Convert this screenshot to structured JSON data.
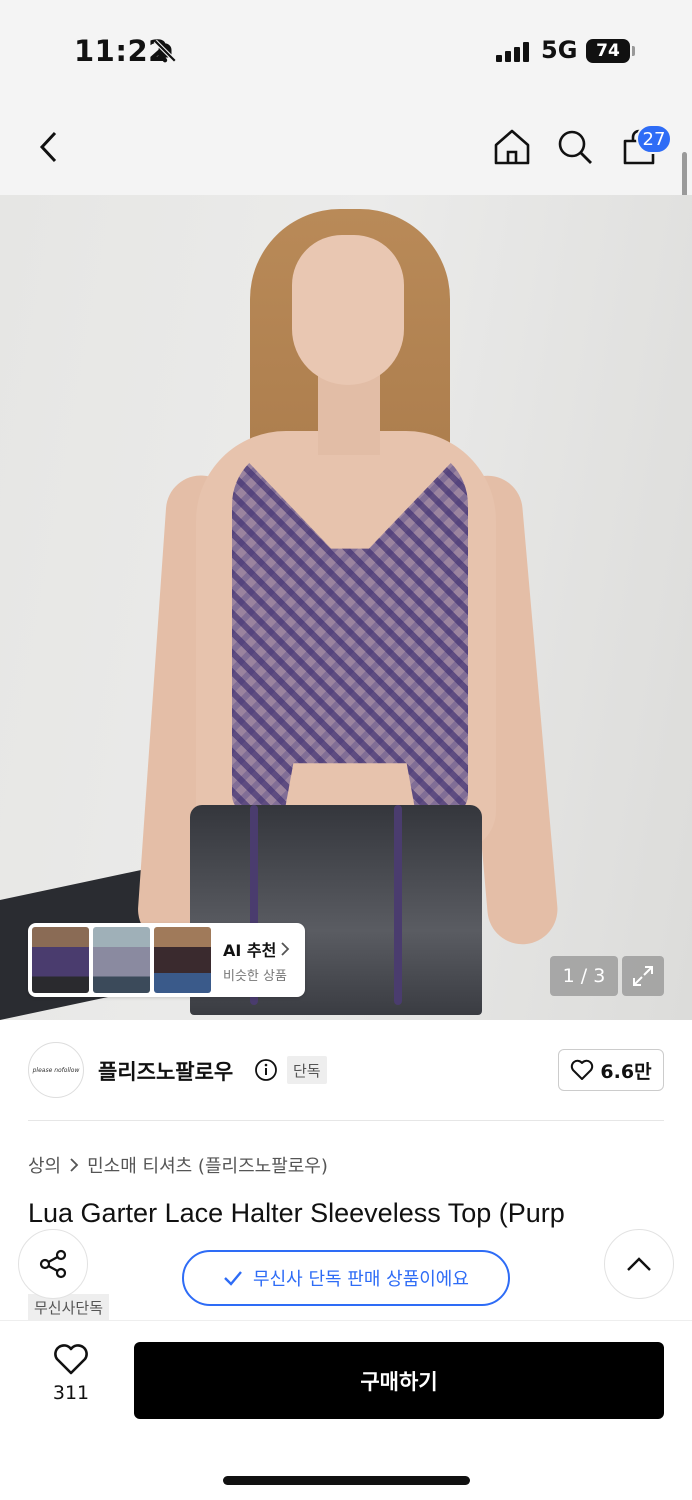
{
  "status_bar": {
    "time": "11:22",
    "network": "5G",
    "battery": "74"
  },
  "header": {
    "cart_count": "27"
  },
  "gallery": {
    "pager": "1 / 3",
    "ai_recommend": {
      "title": "AI 추천",
      "subtitle": "비슷한 상품"
    }
  },
  "brand": {
    "name": "플리즈노팔로우",
    "exclusive_tag": "단독",
    "likes": "6.6만"
  },
  "breadcrumb": {
    "category": "상의",
    "subcategory": "민소매 티셔츠 (플리즈노팔로우)"
  },
  "product": {
    "title": "Lua Garter Lace Halter Sleeveless Top (Purp",
    "exclusive_label": "무신사단독"
  },
  "notice": {
    "text": "무신사 단독 판매 상품이에요"
  },
  "bottom": {
    "wish_count": "311",
    "buy_label": "구매하기"
  },
  "colors": {
    "accent": "#2e6cf6",
    "buy": "#000000"
  }
}
